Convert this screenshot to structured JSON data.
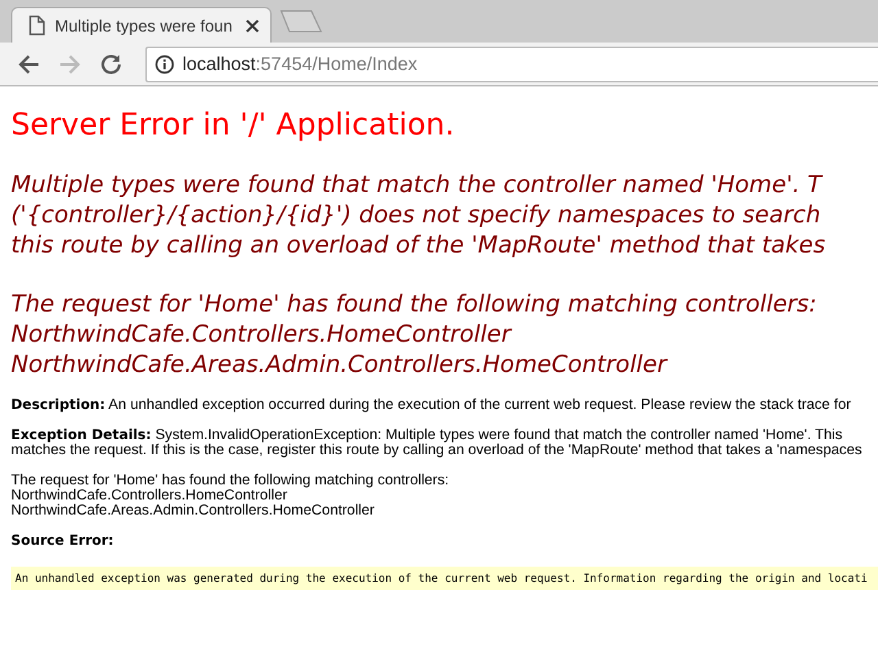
{
  "browser": {
    "tabs": [
      {
        "title": "Multiple types were foun",
        "selected": true
      }
    ],
    "nav": [
      {
        "kind": "back",
        "disabled": false
      },
      {
        "kind": "forward",
        "disabled": true
      },
      {
        "kind": "reload",
        "disabled": false
      }
    ],
    "address": {
      "host": "localhost",
      "path": ":57454/Home/Index"
    }
  },
  "page": {
    "title": "Server Error in '/' Application.",
    "message_lines": [
      "Multiple types were found that match the controller named 'Home'. T",
      "('{controller}/{action}/{id}') does not specify namespaces to search",
      "this route by calling an overload of the 'MapRoute' method that takes"
    ],
    "matching_lines": [
      "The request for 'Home' has found the following matching controllers:",
      "NorthwindCafe.Controllers.HomeController",
      "NorthwindCafe.Areas.Admin.Controllers.HomeController"
    ],
    "description": {
      "label": "Description:",
      "text": "An unhandled exception occurred during the execution of the current web request. Please review the stack trace for"
    },
    "exception_details": {
      "label": "Exception Details:",
      "lines": [
        "System.InvalidOperationException: Multiple types were found that match the controller named 'Home'. This",
        "matches the request. If this is the case, register this route by calling an overload of the 'MapRoute' method that takes a 'namespaces"
      ]
    },
    "detail_matching_lines": [
      "The request for 'Home' has found the following matching controllers:",
      "NorthwindCafe.Controllers.HomeController",
      "NorthwindCafe.Areas.Admin.Controllers.HomeController"
    ],
    "source_error": {
      "label": "Source Error:",
      "code": "An unhandled exception was generated during the execution of the current web request. Information regarding the origin and locati"
    }
  }
}
